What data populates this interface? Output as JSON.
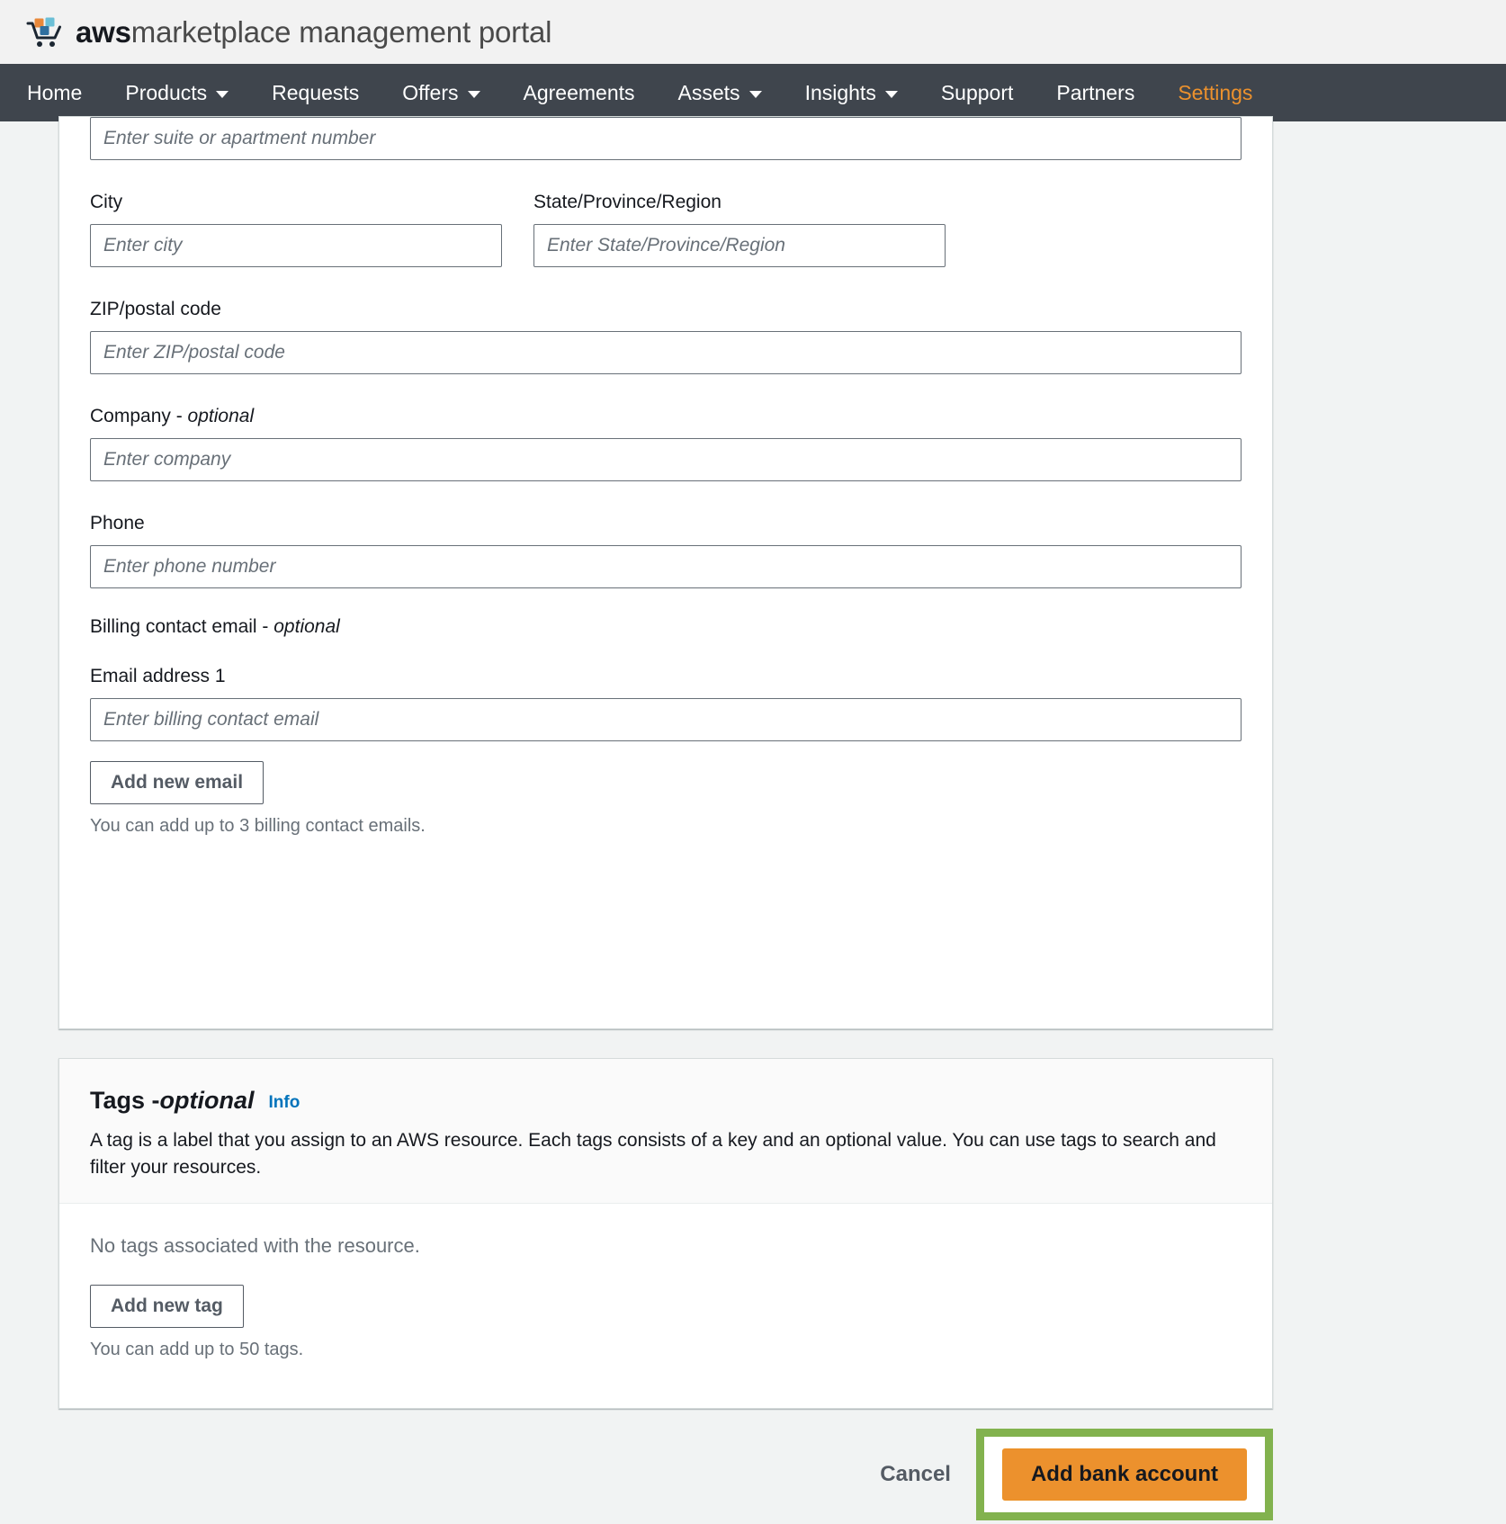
{
  "brand": {
    "logo_icon": "aws-marketplace-cart-icon",
    "title_bold": "aws",
    "title_rest": "marketplace management portal"
  },
  "nav": {
    "accent_color": "#ec912d",
    "bar_color": "#3f454d",
    "items": [
      {
        "label": "Home",
        "has_caret": false,
        "active": false
      },
      {
        "label": "Products",
        "has_caret": true,
        "active": false
      },
      {
        "label": "Requests",
        "has_caret": false,
        "active": false
      },
      {
        "label": "Offers",
        "has_caret": true,
        "active": false
      },
      {
        "label": "Agreements",
        "has_caret": false,
        "active": false
      },
      {
        "label": "Assets",
        "has_caret": true,
        "active": false
      },
      {
        "label": "Insights",
        "has_caret": true,
        "active": false
      },
      {
        "label": "Support",
        "has_caret": false,
        "active": false
      },
      {
        "label": "Partners",
        "has_caret": false,
        "active": false
      },
      {
        "label": "Settings",
        "has_caret": false,
        "active": true
      }
    ]
  },
  "form": {
    "suite": {
      "placeholder": "Enter suite or apartment number",
      "value": ""
    },
    "city": {
      "label": "City",
      "placeholder": "Enter city",
      "value": ""
    },
    "state": {
      "label": "State/Province/Region",
      "placeholder": "Enter State/Province/Region",
      "value": ""
    },
    "zip": {
      "label": "ZIP/postal code",
      "placeholder": "Enter ZIP/postal code",
      "value": ""
    },
    "company": {
      "label": "Company - ",
      "label_optional": "optional",
      "placeholder": "Enter company",
      "value": ""
    },
    "phone": {
      "label": "Phone",
      "placeholder": "Enter phone number",
      "value": ""
    },
    "billing": {
      "group_label": "Billing contact email - ",
      "group_label_optional": "optional",
      "email1_label": "Email address 1",
      "email1_placeholder": "Enter billing contact email",
      "email1_value": "",
      "add_button": "Add new email",
      "hint": "You can add up to 3 billing contact emails."
    }
  },
  "tags": {
    "title": "Tags - ",
    "title_optional": "optional",
    "info_link": "Info",
    "description": "A tag is a label that you assign to an AWS resource. Each tags consists of a key and an optional value. You can use tags to search and filter your resources.",
    "empty_text": "No tags associated with the resource.",
    "add_button": "Add new tag",
    "hint": "You can add up to 50 tags."
  },
  "actions": {
    "cancel": "Cancel",
    "submit": "Add bank account",
    "submit_color": "#ec912d",
    "highlight_color": "#82b24e"
  }
}
